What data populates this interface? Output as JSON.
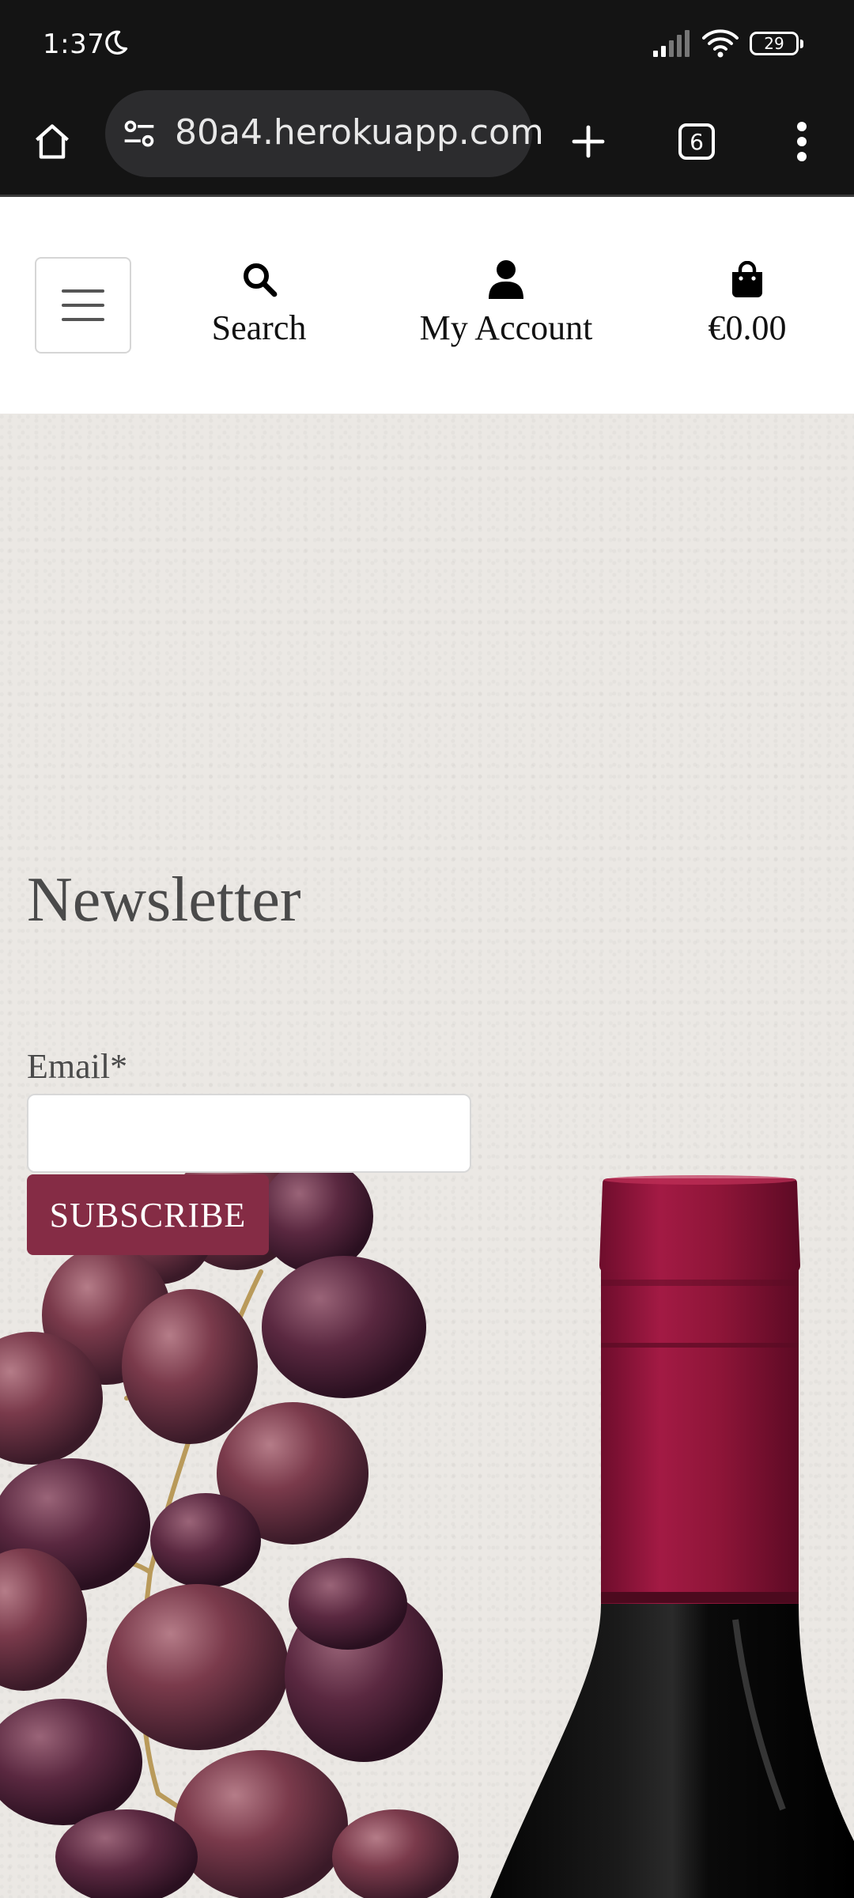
{
  "status_bar": {
    "time": "1:37",
    "battery": "29"
  },
  "browser": {
    "url": "80a4.herokuapp.com",
    "tab_count": "6"
  },
  "header": {
    "nav": {
      "search_label": "Search",
      "account_label": "My Account",
      "cart_total": "€0.00"
    }
  },
  "hero": {
    "newsletter_title": "Newsletter",
    "email_label": "Email*",
    "email_value": "",
    "subscribe_label": "SUBSCRIBE"
  },
  "colors": {
    "brand": "#852c45",
    "browser_bg": "#141414",
    "hero_bg": "#ebe8e4"
  },
  "icons": [
    "moon-icon",
    "signal-icon",
    "wifi-icon",
    "battery-icon",
    "home-icon",
    "site-settings-icon",
    "plus-icon",
    "tabs-icon",
    "more-vert-icon",
    "hamburger-icon",
    "search-icon",
    "user-icon",
    "shopping-bag-icon"
  ]
}
